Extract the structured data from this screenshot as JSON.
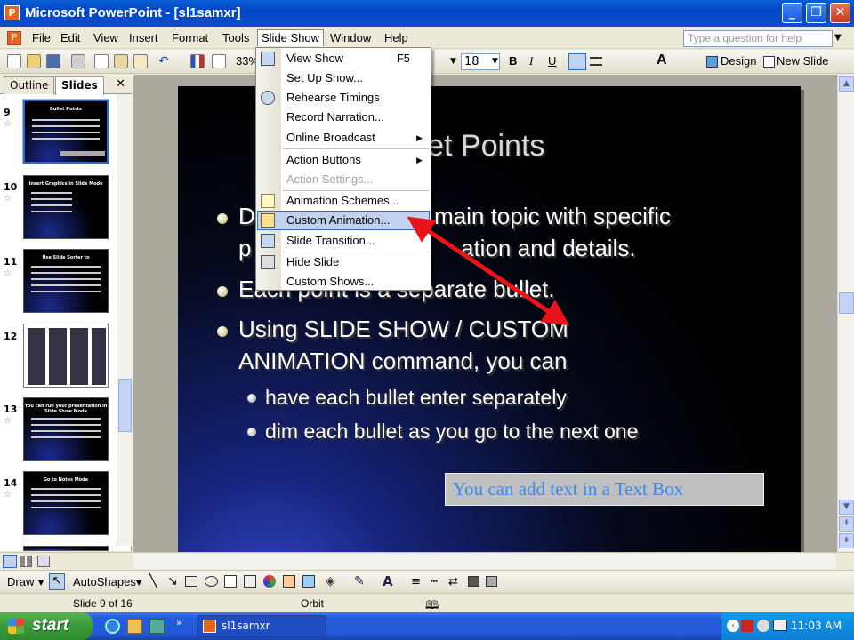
{
  "window": {
    "title": "Microsoft PowerPoint - [sl1samxr]",
    "app_icon_letter": "P"
  },
  "menubar": {
    "items": [
      "File",
      "Edit",
      "View",
      "Insert",
      "Format",
      "Tools",
      "Slide Show",
      "Window",
      "Help"
    ],
    "active": "Slide Show",
    "help_placeholder": "Type a question for help"
  },
  "toolbar": {
    "zoom": "33%",
    "font_size": "18",
    "bold": "B",
    "italic": "I",
    "underline": "U",
    "design_label": "Design",
    "new_slide_label": "New Slide"
  },
  "left_pane": {
    "tabs": [
      "Outline",
      "Slides"
    ],
    "selected_tab": "Slides",
    "thumbnails": [
      {
        "num": "9",
        "title": "Bullet Points"
      },
      {
        "num": "10",
        "title": "Insert Graphics in Slide Mode"
      },
      {
        "num": "11",
        "title": "Use Slide Sorter to"
      },
      {
        "num": "12",
        "title": ""
      },
      {
        "num": "13",
        "title": "You can run your presentation in Slide Show Mode"
      },
      {
        "num": "14",
        "title": "Go to Notes Mode"
      }
    ]
  },
  "slide_show_menu": {
    "items": [
      {
        "label": "View Show",
        "shortcut": "F5"
      },
      {
        "label": "Set Up Show..."
      },
      {
        "label": "Rehearse Timings"
      },
      {
        "label": "Record Narration..."
      },
      {
        "label": "Online Broadcast",
        "submenu": true
      },
      {
        "label": "Action Buttons",
        "submenu": true
      },
      {
        "label": "Action Settings...",
        "disabled": true
      },
      {
        "label": "Animation Schemes..."
      },
      {
        "label": "Custom Animation...",
        "highlighted": true
      },
      {
        "label": "Slide Transition..."
      },
      {
        "label": "Hide Slide"
      },
      {
        "label": "Custom Shows..."
      }
    ]
  },
  "slide": {
    "title_visible": "llet Points",
    "bullet1_line1": "D",
    "bullet1_line1_tail": "main topic with specific",
    "bullet1_line2_head": "p",
    "bullet1_line2_tail": "ation and details.",
    "bullet2": "Each point is a separate bullet.",
    "bullet3_line1": "Using SLIDE SHOW / CUSTOM",
    "bullet3_line2": "ANIMATION command, you can",
    "sub1": "have each bullet enter separately",
    "sub2": "dim each bullet as you go to the next one",
    "textbox": "You can add text in a Text Box"
  },
  "drawbar": {
    "draw_label": "Draw",
    "autoshapes_label": "AutoShapes"
  },
  "statusbar": {
    "slide_info": "Slide 9 of 16",
    "design_name": "Orbit"
  },
  "taskbar": {
    "start_label": "start",
    "task_label": "sl1samxr",
    "clock": "11:03 AM"
  },
  "colors": {
    "arrow": "#E8141A",
    "menu_highlight": "#C1D2EE",
    "titlebar": "#0A5FD6",
    "textbox_text": "#3A8BE8"
  }
}
